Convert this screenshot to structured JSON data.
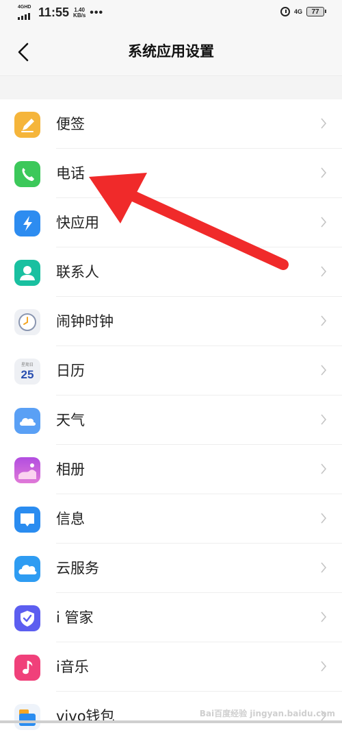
{
  "status_bar": {
    "network_type": "4GHD",
    "time": "11:55",
    "speed_value": "1.40",
    "speed_unit": "KB/s",
    "more": "•••",
    "right_network": "4G",
    "battery": "77"
  },
  "header": {
    "title": "系统应用设置"
  },
  "items": [
    {
      "label": "便签",
      "icon": "note-pencil-icon"
    },
    {
      "label": "电话",
      "icon": "phone-icon"
    },
    {
      "label": "快应用",
      "icon": "quick-app-bolt-icon"
    },
    {
      "label": "联系人",
      "icon": "contacts-person-icon"
    },
    {
      "label": "闹钟时钟",
      "icon": "clock-icon"
    },
    {
      "label": "日历",
      "icon": "calendar-icon",
      "icon_day": "25",
      "icon_caption": "星期日"
    },
    {
      "label": "天气",
      "icon": "weather-cloud-icon"
    },
    {
      "label": "相册",
      "icon": "gallery-icon"
    },
    {
      "label": "信息",
      "icon": "messages-icon"
    },
    {
      "label": "云服务",
      "icon": "cloud-service-icon"
    },
    {
      "label": "i 管家",
      "icon": "i-manager-shield-icon"
    },
    {
      "label": "i音乐",
      "icon": "music-note-icon"
    },
    {
      "label": "vivo钱包",
      "icon": "wallet-icon"
    }
  ],
  "watermark": "Bai百度经验 jingyan.baidu.com",
  "colors": {
    "annotation_arrow": "#f02a2a",
    "note": "#f5b53b",
    "phone": "#3cc85a",
    "quick_app": "#2d8cf0",
    "contacts": "#19c0a0",
    "weather": "#5aa0f5",
    "gallery": "#b24de0",
    "messages": "#2a8cf0",
    "cloud": "#2e9cf2",
    "manager": "#5c5ef0",
    "music": "#f0407a"
  }
}
